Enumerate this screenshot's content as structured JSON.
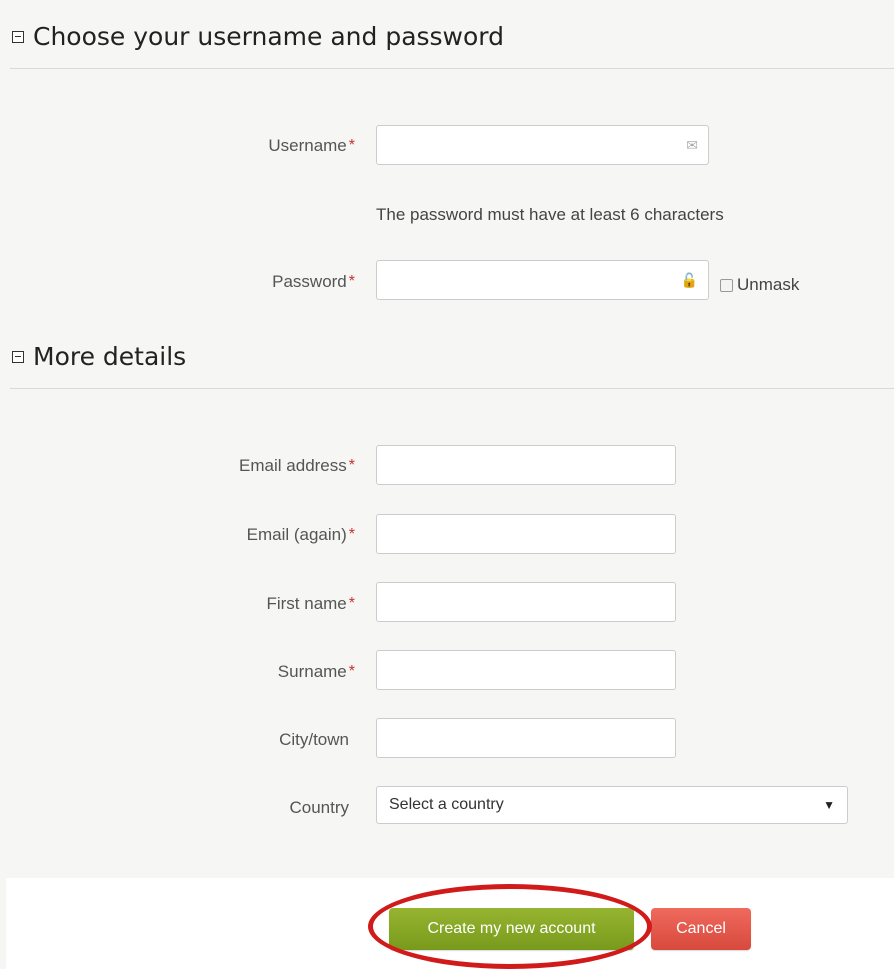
{
  "section1": {
    "title": "Choose your username and password"
  },
  "username": {
    "label": "Username",
    "required": "*",
    "icon": "envelope-icon",
    "value": ""
  },
  "password_hint": "The password must have at least 6 characters",
  "password": {
    "label": "Password",
    "required": "*",
    "icon": "lock-icon",
    "value": "",
    "unmask_label": "Unmask"
  },
  "section2": {
    "title": "More details"
  },
  "fields": {
    "email": {
      "label": "Email address",
      "required": "*",
      "value": ""
    },
    "email_again": {
      "label": "Email (again)",
      "required": "*",
      "value": ""
    },
    "first_name": {
      "label": "First name",
      "required": "*",
      "value": ""
    },
    "surname": {
      "label": "Surname",
      "required": "*",
      "value": ""
    },
    "city": {
      "label": "City/town",
      "value": ""
    },
    "country": {
      "label": "Country",
      "selected": "Select a country"
    }
  },
  "buttons": {
    "create": "Create my new account",
    "cancel": "Cancel"
  },
  "colors": {
    "required": "#c9302c",
    "create_button": "#88a82a",
    "cancel_button": "#e25a4c",
    "highlight": "#d11a1a"
  }
}
